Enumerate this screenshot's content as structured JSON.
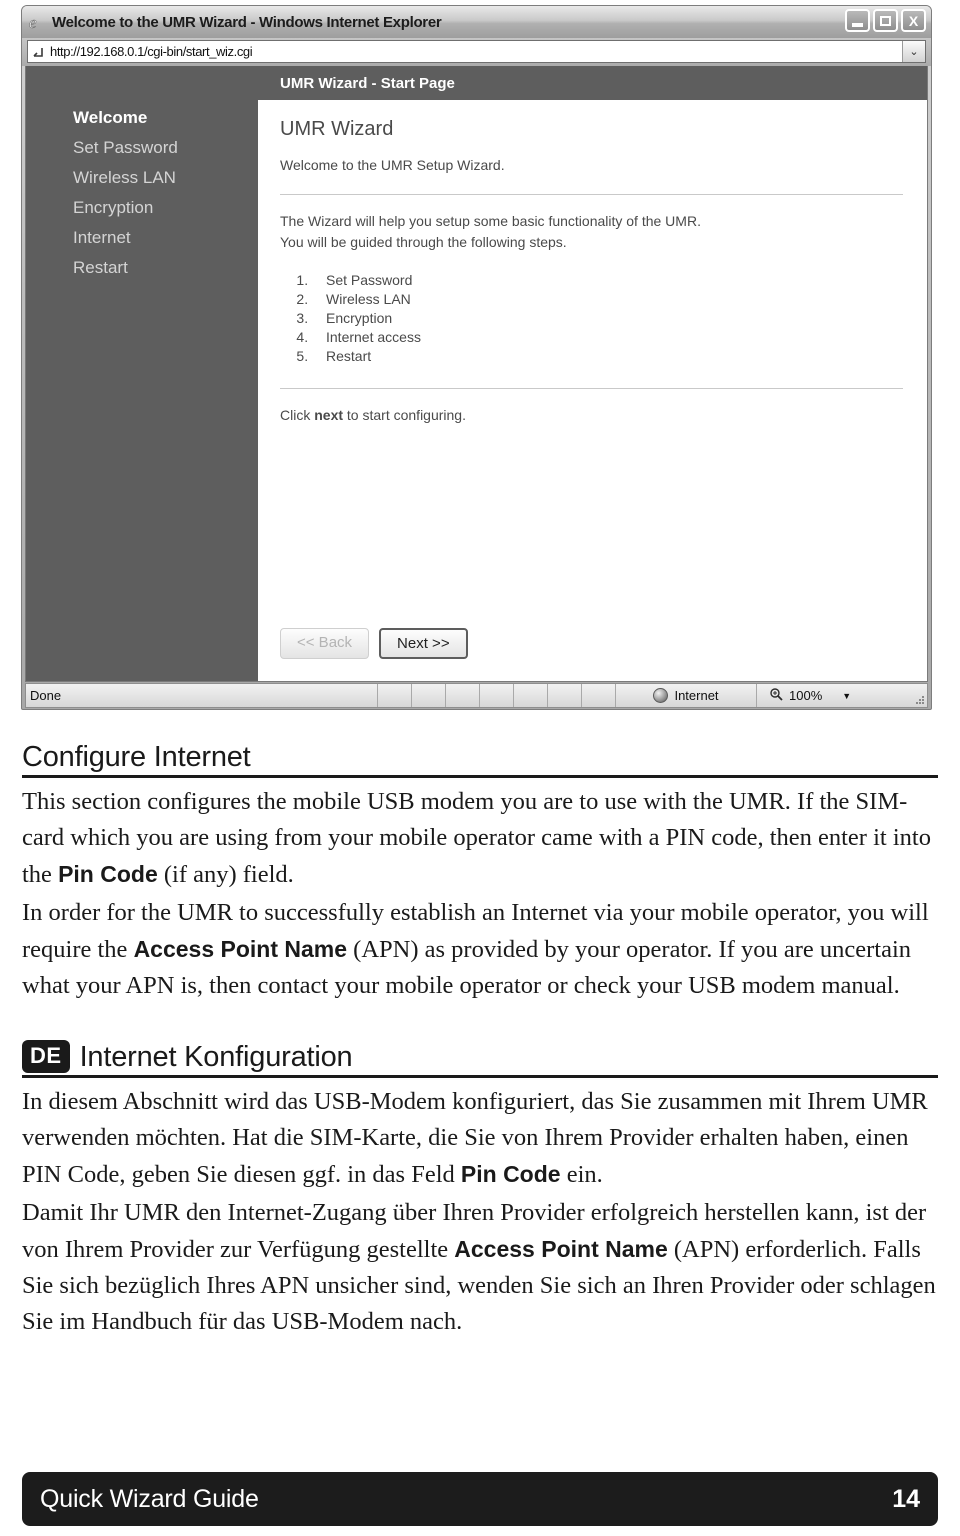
{
  "browser": {
    "title": "Welcome to the UMR Wizard - Windows Internet Explorer",
    "ie_icon": "ie-logo-icon",
    "window_controls": {
      "minimize": "minimize-icon",
      "maximize": "maximize-icon",
      "close": "close-icon",
      "close_glyph": "X"
    },
    "address": {
      "icon": "page-icon",
      "url": "http://192.168.0.1/cgi-bin/start_wiz.cgi",
      "dropdown_glyph": "⌄"
    },
    "statusbar": {
      "status": "Done",
      "zone_icon": "globe-icon",
      "zone_label": "Internet",
      "zoom_icon": "zoom-magnifier-icon",
      "zoom_level": "100%",
      "zoom_dropdown_glyph": "▼",
      "resize_grip": "resize-grip-icon"
    }
  },
  "wizard": {
    "sidebar": [
      {
        "label": "Welcome",
        "active": true
      },
      {
        "label": "Set Password",
        "active": false
      },
      {
        "label": "Wireless LAN",
        "active": false
      },
      {
        "label": "Encryption",
        "active": false
      },
      {
        "label": "Internet",
        "active": false
      },
      {
        "label": "Restart",
        "active": false
      }
    ],
    "header_title": "UMR Wizard - Start Page",
    "heading": "UMR Wizard",
    "intro": "Welcome to the UMR Setup Wizard.",
    "description_line1": "The Wizard will help you setup some basic functionality of the UMR.",
    "description_line2": "You will be guided through the following steps.",
    "steps": [
      "Set Password",
      "Wireless LAN",
      "Encryption",
      "Internet access",
      "Restart"
    ],
    "click_next_pre": "Click ",
    "click_next_bold": "next",
    "click_next_post": " to start configuring.",
    "back_button": "<< Back",
    "next_button": "Next >>"
  },
  "document": {
    "en_section": {
      "title": "Configure Internet",
      "p1_a": "This section configures the mobile USB modem you are to use with the UMR. If the SIM-card which you are using from your mobile operator came with a PIN code, then enter it into the ",
      "p1_bold": "Pin Code",
      "p1_b": " (if any) field.",
      "p2_a": "In order for the UMR to successfully establish an Internet via your mobile operator, you will require the ",
      "p2_bold": "Access Point Name",
      "p2_b": " (APN) as provided by your operator. If you are uncertain what your APN is, then contact your mobile operator or check your USB modem manual."
    },
    "de_section": {
      "badge": "DE",
      "title": "Internet Konfiguration",
      "p1_a": "In diesem Abschnitt wird das USB-Modem konfiguriert, das Sie zusammen mit Ihrem UMR verwenden möchten. Hat die SIM-Karte, die Sie von Ihrem Provider erhalten haben, einen PIN Code, geben Sie diesen ggf. in das Feld ",
      "p1_bold": "Pin Code",
      "p1_b": " ein.",
      "p2_a": "Damit Ihr UMR den Internet-Zugang über Ihren Provider erfolgreich herstellen kann, ist der von Ihrem Provider zur Verfügung gestellte ",
      "p2_bold": "Access Point Name",
      "p2_b": " (APN) erforderlich. Falls Sie sich bezüglich Ihres APN unsicher sind, wenden Sie sich an Ihren Provider oder schlagen Sie im Handbuch für das USB-Modem nach."
    }
  },
  "footer": {
    "title": "Quick Wizard Guide",
    "page_number": "14"
  },
  "colors": {
    "sidebar_bg": "#5e5e5e",
    "footer_bg": "#1c1c1c",
    "text": "#1a1a1a"
  }
}
